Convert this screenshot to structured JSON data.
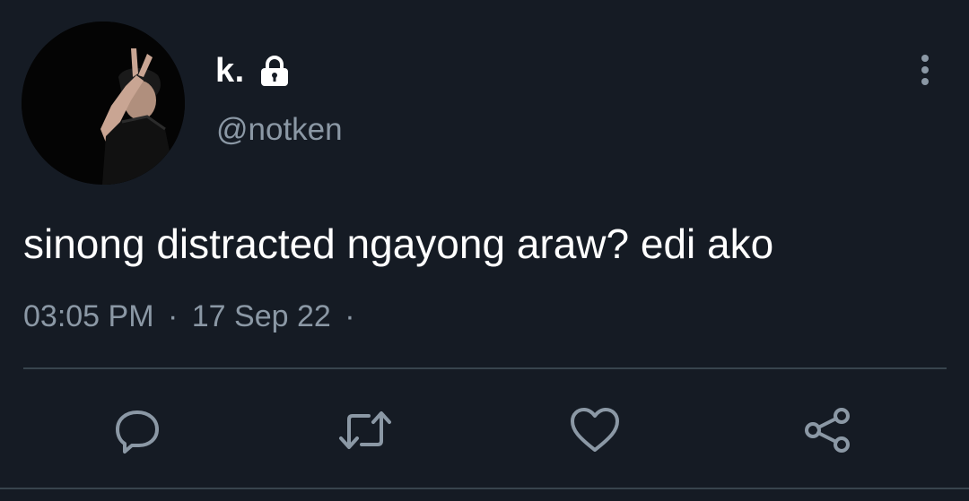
{
  "author": {
    "display_name": "k.",
    "handle": "@notken",
    "avatar_icon": "profile-photo",
    "protected_icon": "lock-icon"
  },
  "tweet": {
    "text": "sinong distracted ngayong araw? edi ako",
    "time": "03:05 PM",
    "separator": "·",
    "date": "17 Sep 22",
    "trailing_separator": "·"
  },
  "actions": [
    {
      "name": "reply",
      "icon": "reply-icon"
    },
    {
      "name": "retweet",
      "icon": "retweet-icon"
    },
    {
      "name": "like",
      "icon": "heart-icon"
    },
    {
      "name": "share",
      "icon": "share-icon"
    }
  ],
  "menu": {
    "icon": "more-vertical-icon"
  },
  "colors": {
    "background": "#151b24",
    "text_primary": "#ffffff",
    "text_secondary": "#8b98a5",
    "divider": "#38444d"
  }
}
